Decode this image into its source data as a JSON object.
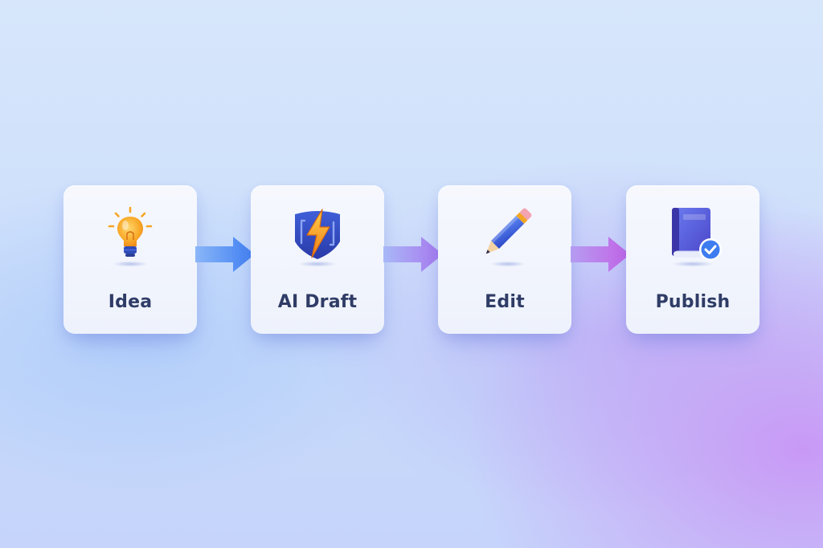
{
  "steps": [
    {
      "label": "Idea",
      "icon": "lightbulb-icon"
    },
    {
      "label": "AI Draft",
      "icon": "lightning-shield-icon"
    },
    {
      "label": "Edit",
      "icon": "pencil-icon"
    },
    {
      "label": "Publish",
      "icon": "book-check-icon"
    }
  ],
  "colors": {
    "label_text": "#2f3c66",
    "arrow_blue": "#4f8ef5",
    "arrow_violet": "#b46ae8",
    "bulb": "#f6a623",
    "bolt": "#f39a1f",
    "pencil": "#3a63e0",
    "book": "#5f5fe0",
    "check": "#3e7df0"
  }
}
